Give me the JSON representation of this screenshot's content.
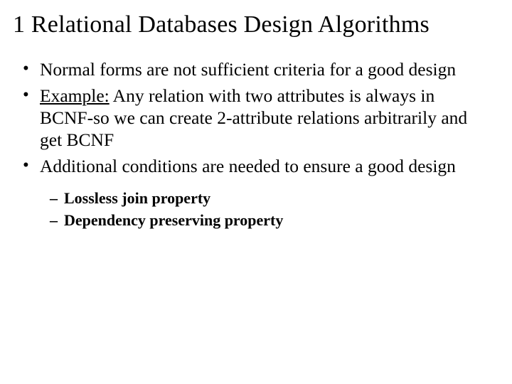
{
  "title": "1 Relational Databases Design Algorithms",
  "bullets": [
    {
      "text": "Normal forms are not sufficient criteria for a good design"
    },
    {
      "prefix": "Example:",
      "text": " Any relation with two attributes is always in BCNF-so we can create 2-attribute relations arbitrarily and get BCNF"
    },
    {
      "text": "Additional conditions are needed to ensure a good design"
    }
  ],
  "subbullets": [
    "Lossless join property",
    "Dependency preserving property"
  ]
}
